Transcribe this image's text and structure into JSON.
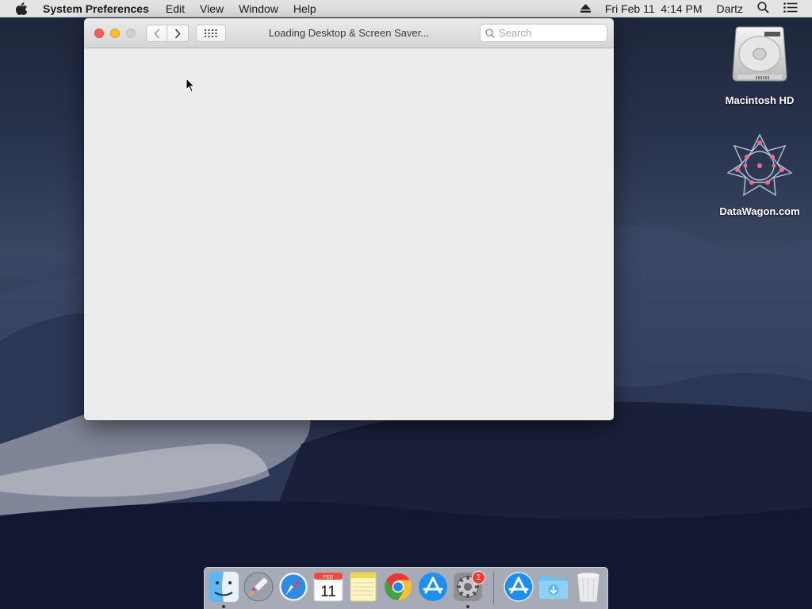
{
  "menubar": {
    "app_name": "System Preferences",
    "items": [
      "Edit",
      "View",
      "Window",
      "Help"
    ],
    "clock": "Fri Feb 11  4:14 PM",
    "user": "Dartz"
  },
  "window": {
    "title": "Loading Desktop & Screen Saver...",
    "search_placeholder": "Search"
  },
  "desktop": {
    "icons": [
      {
        "label": "Macintosh HD",
        "icon": "hard-drive-icon"
      },
      {
        "label": "DataWagon.com",
        "icon": "datawagon-icon"
      }
    ]
  },
  "dock": {
    "apps": [
      {
        "name": "Finder",
        "icon": "finder-icon",
        "running": true
      },
      {
        "name": "Launchpad",
        "icon": "launchpad-icon",
        "running": false
      },
      {
        "name": "Safari",
        "icon": "safari-icon",
        "running": false
      },
      {
        "name": "Calendar",
        "icon": "calendar-icon",
        "running": false,
        "month": "FEB",
        "day": "11"
      },
      {
        "name": "Notes",
        "icon": "notes-icon",
        "running": false
      },
      {
        "name": "Chrome",
        "icon": "chrome-icon",
        "running": false
      },
      {
        "name": "App Store",
        "icon": "app-store-icon",
        "running": false
      },
      {
        "name": "System Preferences",
        "icon": "gear-icon",
        "running": true,
        "badge": "1"
      }
    ],
    "others": [
      {
        "name": "App Store Download",
        "icon": "app-store-icon"
      },
      {
        "name": "Downloads",
        "icon": "downloads-folder-icon"
      },
      {
        "name": "Trash",
        "icon": "trash-icon"
      }
    ]
  },
  "colors": {
    "close": "#fc5f57",
    "minimize": "#fdbc2e",
    "zoom_disabled": "#d0d0d0",
    "badge": "#ef3d34"
  }
}
